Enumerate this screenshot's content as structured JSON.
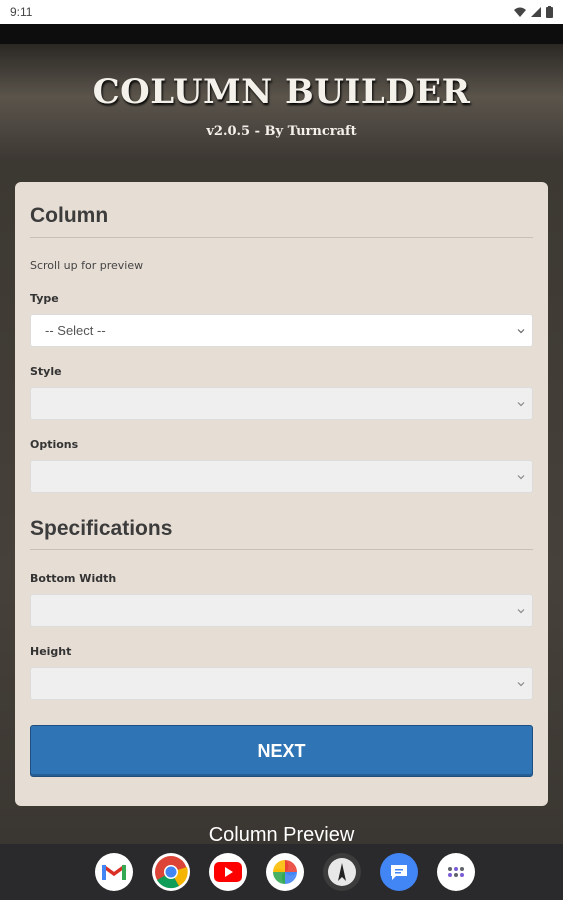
{
  "status_bar": {
    "time": "9:11"
  },
  "header": {
    "title": "COLUMN BUILDER",
    "version": "v2.0.5 - By Turncraft"
  },
  "column_section": {
    "title": "Column",
    "hint": "Scroll up for preview"
  },
  "fields": {
    "type": {
      "label": "Type",
      "value": "-- Select --"
    },
    "style": {
      "label": "Style",
      "value": ""
    },
    "options": {
      "label": "Options",
      "value": ""
    }
  },
  "spec_section": {
    "title": "Specifications"
  },
  "spec_fields": {
    "bottom_width": {
      "label": "Bottom Width",
      "value": ""
    },
    "height": {
      "label": "Height",
      "value": ""
    }
  },
  "next_label": "NEXT",
  "preview_label": "Column Preview",
  "dock_apps": [
    "gmail-icon",
    "chrome-icon",
    "youtube-icon",
    "photos-icon",
    "app-icon",
    "messages-icon",
    "app-drawer-icon"
  ],
  "colors": {
    "accent": "#2f74b5",
    "card": "#e6ddd5"
  }
}
